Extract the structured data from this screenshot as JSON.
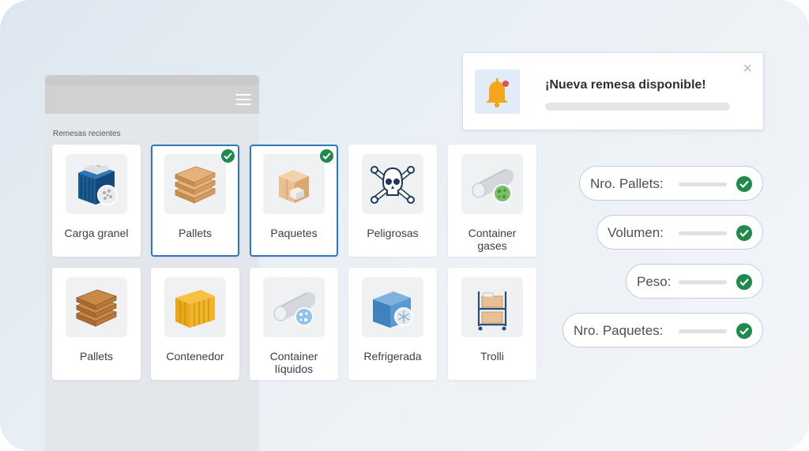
{
  "sidebar": {
    "section_label": "Remesas recientes"
  },
  "cards": [
    {
      "label": "Carga granel",
      "selected": false,
      "icon": "bulk-container-icon"
    },
    {
      "label": "Pallets",
      "selected": true,
      "icon": "pallet-stack-icon"
    },
    {
      "label": "Paquetes",
      "selected": true,
      "icon": "boxes-icon"
    },
    {
      "label": "Peligrosas",
      "selected": false,
      "icon": "skull-crossbones-icon"
    },
    {
      "label": "Container\ngases",
      "selected": false,
      "icon": "gas-tank-icon"
    },
    {
      "label": "Pallets",
      "selected": false,
      "icon": "wooden-pallets-icon"
    },
    {
      "label": "Contenedor",
      "selected": false,
      "icon": "shipping-container-icon"
    },
    {
      "label": "Container\nlíquidos",
      "selected": false,
      "icon": "liquid-tank-icon"
    },
    {
      "label": "Refrigerada",
      "selected": false,
      "icon": "refrigerated-container-icon"
    },
    {
      "label": "Trolli",
      "selected": false,
      "icon": "trolley-icon"
    }
  ],
  "notification": {
    "title": "¡Nueva remesa disponible!",
    "close_symbol": "×"
  },
  "fields": {
    "pallets_label": "Nro. Pallets:",
    "volumen_label": "Volumen:",
    "peso_label": "Peso:",
    "paquetes_label": "Nro. Paquetes:"
  },
  "colors": {
    "accent": "#2f78c0",
    "success": "#1f8a4c",
    "bell": "#f2a71b"
  }
}
